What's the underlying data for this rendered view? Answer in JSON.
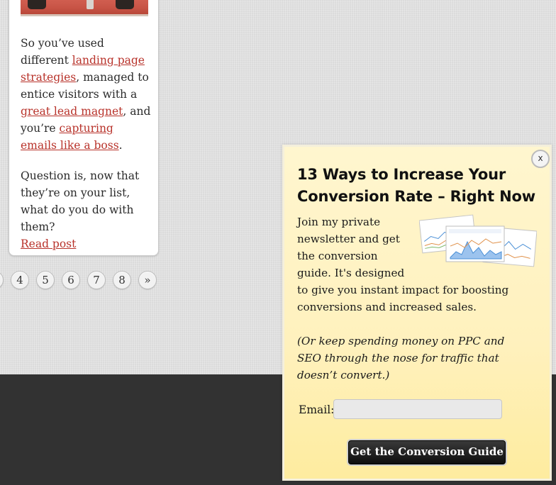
{
  "post": {
    "intro": "So you’ve used different ",
    "link1": "landing page strategies",
    "mid1": ", managed to entice visitors with a ",
    "link2": "great lead magnet",
    "mid2": ", and you’re ",
    "link3": "capturing emails like a boss",
    "end": ".",
    "question": "Question is, now that they’re on your list, what do you do with them?",
    "read_more": "Read post"
  },
  "pagination": {
    "pages": [
      "4",
      "5",
      "6",
      "7",
      "8"
    ],
    "next": "»"
  },
  "popup": {
    "close_label": "x",
    "title": "13 Ways to Increase Your Conversion Rate – Right Now",
    "body": "Join my private newsletter and get the conversion guide. It's designed to give you instant impact for boosting conversions and increased sales.",
    "note": "(Or keep spending money on PPC and SEO through the nose for traffic that doesn’t convert.)",
    "email_label": "Email:",
    "email_value": "",
    "email_placeholder": "",
    "cta_label": "Get the Conversion Guide"
  },
  "colors": {
    "link": "#b8322a",
    "popup_bg": "#fff2c2",
    "footer": "#323232"
  }
}
